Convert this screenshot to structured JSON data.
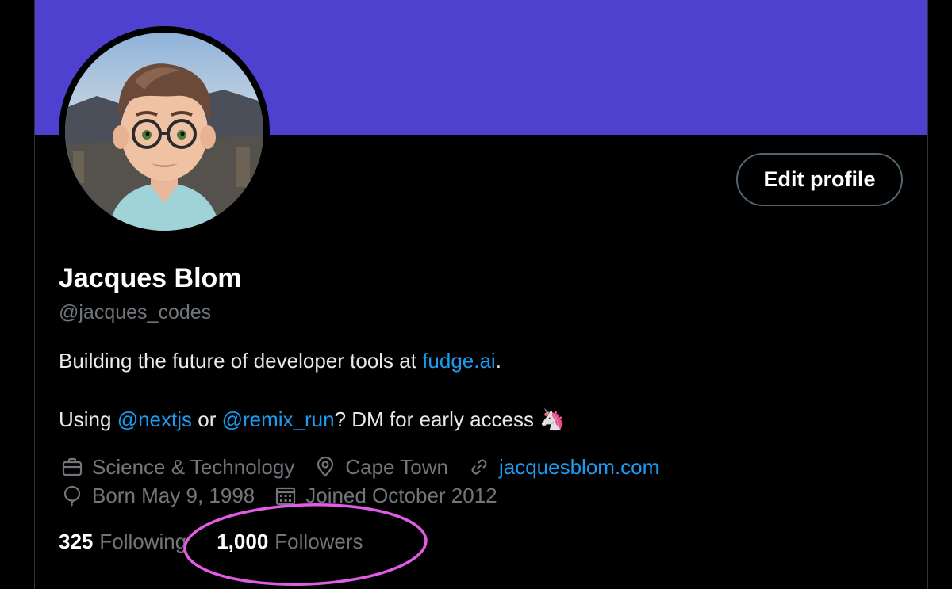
{
  "profile": {
    "display_name": "Jacques Blom",
    "handle": "@jacques_codes",
    "edit_button_label": "Edit profile",
    "bio": {
      "line1_prefix": "Building the future of developer tools at ",
      "line1_link": "fudge.ai",
      "line1_suffix": ".",
      "line2_prefix": "Using ",
      "line2_link1": "@nextjs",
      "line2_middle": " or ",
      "line2_link2": "@remix_run",
      "line2_suffix": "? DM for early access 🦄"
    },
    "meta": {
      "category": "Science & Technology",
      "location": "Cape Town",
      "website": "jacquesblom.com",
      "birthday": "Born May 9, 1998",
      "joined": "Joined October 2012"
    },
    "stats": {
      "following_count": "325",
      "following_label": "Following",
      "followers_count": "1,000",
      "followers_label": "Followers"
    }
  },
  "colors": {
    "banner": "#4f41cf",
    "link": "#1d9bf0",
    "muted": "#71767b",
    "highlight": "#e25ce6"
  },
  "icons": {
    "category": "briefcase-icon",
    "location": "map-pin-icon",
    "website": "link-icon",
    "birthday": "balloon-icon",
    "joined": "calendar-icon"
  }
}
